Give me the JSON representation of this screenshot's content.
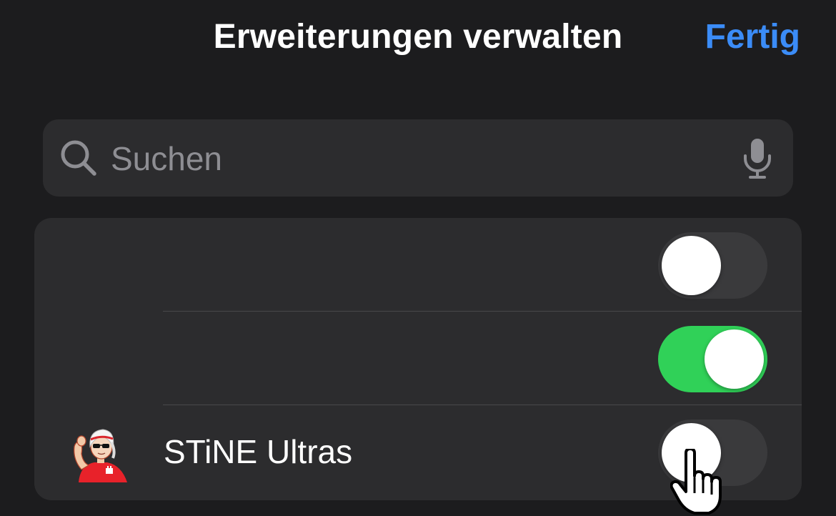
{
  "header": {
    "title": "Erweiterungen verwalten",
    "done_label": "Fertig"
  },
  "search": {
    "placeholder": "Suchen",
    "value": "",
    "icon": "search-icon",
    "mic_icon": "microphone-icon"
  },
  "extensions": [
    {
      "name": "",
      "enabled": false
    },
    {
      "name": "",
      "enabled": true
    },
    {
      "name": "STiNE Ultras",
      "enabled": false,
      "icon": "stine-ultras-avatar-icon"
    }
  ],
  "colors": {
    "background": "#1c1c1e",
    "group_background": "#2c2c2e",
    "accent": "#3b8cf7",
    "toggle_on": "#30d158",
    "toggle_off": "#3a3a3c",
    "placeholder": "#8e8e93"
  },
  "cursor": "hand-pointer-icon"
}
